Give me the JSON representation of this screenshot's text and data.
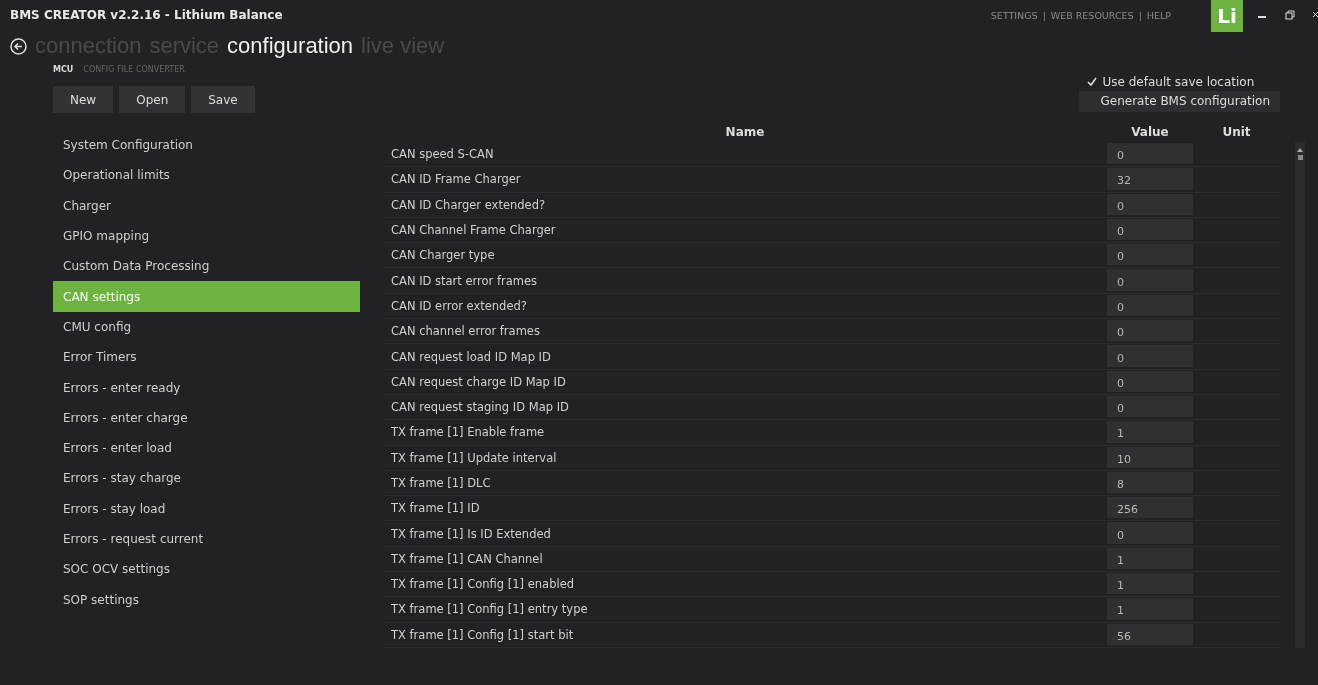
{
  "window": {
    "title": "BMS CREATOR v2.2.16 - Lithium Balance",
    "links": [
      "SETTINGS",
      "WEB RESOURCES",
      "HELP"
    ],
    "link_separator": "|",
    "logo": "Li"
  },
  "nav": [
    {
      "label": "connection",
      "selected": false
    },
    {
      "label": "service",
      "selected": false
    },
    {
      "label": "configuration",
      "selected": true
    },
    {
      "label": "live view",
      "selected": false
    }
  ],
  "subnav": [
    {
      "label": "MCU",
      "selected": true
    },
    {
      "label": "CONFIG FILE CONVERTER",
      "selected": false
    }
  ],
  "buttons": [
    "New",
    "Open",
    "Save"
  ],
  "default_save": {
    "label": "Use default save location",
    "checked": true
  },
  "generate_button": "Generate BMS configuration",
  "sidebar": {
    "items": [
      {
        "label": "System Configuration",
        "selected": false
      },
      {
        "label": "Operational limits",
        "selected": false
      },
      {
        "label": "Charger",
        "selected": false
      },
      {
        "label": "GPIO mapping",
        "selected": false
      },
      {
        "label": "Custom Data Processing",
        "selected": false
      },
      {
        "label": "CAN settings",
        "selected": true
      },
      {
        "label": "CMU config",
        "selected": false
      },
      {
        "label": "Error Timers",
        "selected": false
      },
      {
        "label": "Errors - enter ready",
        "selected": false
      },
      {
        "label": "Errors - enter charge",
        "selected": false
      },
      {
        "label": "Errors - enter load",
        "selected": false
      },
      {
        "label": "Errors - stay charge",
        "selected": false
      },
      {
        "label": "Errors - stay load",
        "selected": false
      },
      {
        "label": "Errors - request current",
        "selected": false
      },
      {
        "label": "SOC OCV settings",
        "selected": false
      },
      {
        "label": "SOP settings",
        "selected": false
      }
    ]
  },
  "table": {
    "columns": [
      "Name",
      "Value",
      "Unit"
    ],
    "rows": [
      {
        "name": "CAN speed S-CAN",
        "value": "0"
      },
      {
        "name": "CAN ID Frame Charger",
        "value": "32"
      },
      {
        "name": "CAN ID Charger extended?",
        "value": "0"
      },
      {
        "name": "CAN Channel Frame Charger",
        "value": "0"
      },
      {
        "name": "CAN Charger type",
        "value": "0"
      },
      {
        "name": "CAN ID start error frames",
        "value": "0"
      },
      {
        "name": "CAN ID error extended?",
        "value": "0"
      },
      {
        "name": "CAN channel error frames",
        "value": "0"
      },
      {
        "name": "CAN request load ID Map ID",
        "value": "0"
      },
      {
        "name": "CAN request charge ID Map ID",
        "value": "0"
      },
      {
        "name": "CAN request staging ID Map ID",
        "value": "0"
      },
      {
        "name": "TX frame [1] Enable frame",
        "value": "1"
      },
      {
        "name": "TX frame [1] Update interval",
        "value": "10"
      },
      {
        "name": "TX frame [1] DLC",
        "value": "8"
      },
      {
        "name": "TX frame [1] ID",
        "value": "256"
      },
      {
        "name": "TX frame [1] Is ID Extended",
        "value": "0"
      },
      {
        "name": "TX frame [1] CAN Channel",
        "value": "1"
      },
      {
        "name": "TX frame [1] Config [1] enabled",
        "value": "1"
      },
      {
        "name": "TX frame [1] Config [1] entry type",
        "value": "1"
      },
      {
        "name": "TX frame [1] Config [1] start bit",
        "value": "56"
      }
    ]
  }
}
